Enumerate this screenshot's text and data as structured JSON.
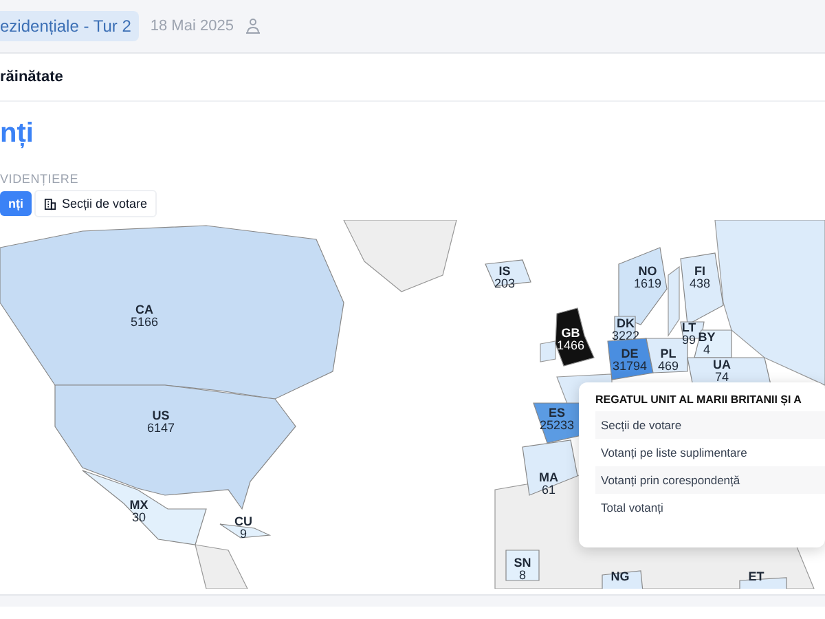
{
  "top_bar": {
    "election_badge": "ezidențiale - Tur 2",
    "date": "18 Mai 2025"
  },
  "section_tab": "răinătate",
  "heading": "nți",
  "highlight": {
    "label": "VIDENȚIERE",
    "options": [
      {
        "label": "nți",
        "selected": true
      },
      {
        "label": "Secții de votare",
        "selected": false
      }
    ]
  },
  "map": {
    "countries": [
      {
        "code": "CA",
        "count": "5166",
        "color": "#c6dcf4"
      },
      {
        "code": "US",
        "count": "6147",
        "color": "#c6dcf4"
      },
      {
        "code": "MX",
        "count": "30",
        "color": "#e2f0fc"
      },
      {
        "code": "CU",
        "count": "9",
        "color": "#e2f0fc"
      },
      {
        "code": "IS",
        "count": "203",
        "color": "#dcebfa"
      },
      {
        "code": "NO",
        "count": "1619",
        "color": "#cfe3f7"
      },
      {
        "code": "FI",
        "count": "438",
        "color": "#dcebfa"
      },
      {
        "code": "DK",
        "count": "3222",
        "color": "#cfe3f7"
      },
      {
        "code": "GB",
        "count": "1466",
        "color": "#111111"
      },
      {
        "code": "DE",
        "count": "31794",
        "color": "#4a8ee0"
      },
      {
        "code": "PL",
        "count": "469",
        "color": "#dcebfa"
      },
      {
        "code": "LT",
        "count": "99",
        "color": "#dcebfa"
      },
      {
        "code": "BY",
        "count": "4",
        "color": "#e2f0fc"
      },
      {
        "code": "UA",
        "count": "74",
        "color": "#dcebfa"
      },
      {
        "code": "ES",
        "count": "25233",
        "color": "#5b9be3"
      },
      {
        "code": "MA",
        "count": "61",
        "color": "#dcebfa"
      },
      {
        "code": "SN",
        "count": "8",
        "color": "#e2f0fc"
      },
      {
        "code": "NG",
        "color": "#dcebfa"
      },
      {
        "code": "ET",
        "color": "#dcebfa"
      }
    ],
    "tooltip": {
      "title": "REGATUL UNIT AL MARII BRITANII ȘI A",
      "rows": [
        "Secții de votare",
        "Votanți pe liste suplimentare",
        "Votanți prin corespondență",
        "Total votanți"
      ]
    }
  }
}
